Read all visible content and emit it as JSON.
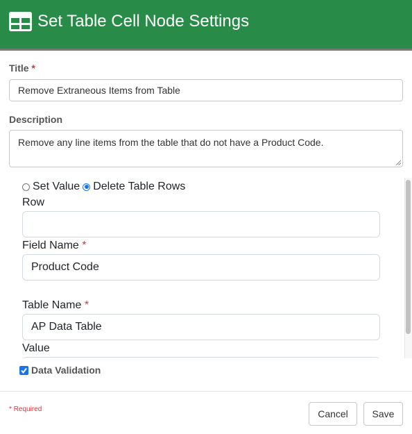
{
  "header": {
    "icon": "table-icon",
    "title": "Set Table Cell Node Settings",
    "color": "#288c48"
  },
  "form": {
    "title_label": "Title",
    "required_mark": "*",
    "title_value": "Remove Extraneous Items from Table",
    "description_label": "Description",
    "description_value": "Remove any line items from the table that do not have a Product Code."
  },
  "mode": {
    "options": [
      {
        "label": "Set Value",
        "checked": false
      },
      {
        "label": "Delete Table Rows",
        "checked": true
      }
    ]
  },
  "fields": {
    "row_label": "Row",
    "row_value": "",
    "field_name_label": "Field Name",
    "field_name_value": "Product Code",
    "table_name_label": "Table Name",
    "table_name_value": "AP Data Table",
    "value_label": "Value",
    "value_value": ""
  },
  "data_validation": {
    "label": "Data Validation",
    "checked": true
  },
  "footer": {
    "required_note_mark": "*",
    "required_note": "Required",
    "cancel_label": "Cancel",
    "save_label": "Save"
  }
}
